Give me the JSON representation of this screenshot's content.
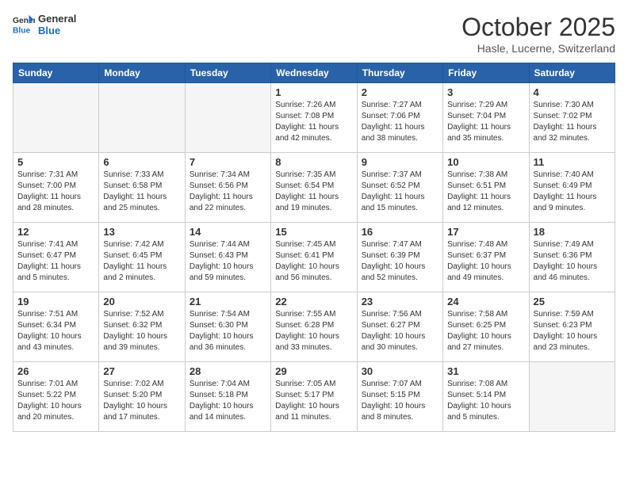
{
  "header": {
    "logo_line1": "General",
    "logo_line2": "Blue",
    "month": "October 2025",
    "location": "Hasle, Lucerne, Switzerland"
  },
  "weekdays": [
    "Sunday",
    "Monday",
    "Tuesday",
    "Wednesday",
    "Thursday",
    "Friday",
    "Saturday"
  ],
  "weeks": [
    [
      {
        "day": "",
        "info": ""
      },
      {
        "day": "",
        "info": ""
      },
      {
        "day": "",
        "info": ""
      },
      {
        "day": "1",
        "info": "Sunrise: 7:26 AM\nSunset: 7:08 PM\nDaylight: 11 hours\nand 42 minutes."
      },
      {
        "day": "2",
        "info": "Sunrise: 7:27 AM\nSunset: 7:06 PM\nDaylight: 11 hours\nand 38 minutes."
      },
      {
        "day": "3",
        "info": "Sunrise: 7:29 AM\nSunset: 7:04 PM\nDaylight: 11 hours\nand 35 minutes."
      },
      {
        "day": "4",
        "info": "Sunrise: 7:30 AM\nSunset: 7:02 PM\nDaylight: 11 hours\nand 32 minutes."
      }
    ],
    [
      {
        "day": "5",
        "info": "Sunrise: 7:31 AM\nSunset: 7:00 PM\nDaylight: 11 hours\nand 28 minutes."
      },
      {
        "day": "6",
        "info": "Sunrise: 7:33 AM\nSunset: 6:58 PM\nDaylight: 11 hours\nand 25 minutes."
      },
      {
        "day": "7",
        "info": "Sunrise: 7:34 AM\nSunset: 6:56 PM\nDaylight: 11 hours\nand 22 minutes."
      },
      {
        "day": "8",
        "info": "Sunrise: 7:35 AM\nSunset: 6:54 PM\nDaylight: 11 hours\nand 19 minutes."
      },
      {
        "day": "9",
        "info": "Sunrise: 7:37 AM\nSunset: 6:52 PM\nDaylight: 11 hours\nand 15 minutes."
      },
      {
        "day": "10",
        "info": "Sunrise: 7:38 AM\nSunset: 6:51 PM\nDaylight: 11 hours\nand 12 minutes."
      },
      {
        "day": "11",
        "info": "Sunrise: 7:40 AM\nSunset: 6:49 PM\nDaylight: 11 hours\nand 9 minutes."
      }
    ],
    [
      {
        "day": "12",
        "info": "Sunrise: 7:41 AM\nSunset: 6:47 PM\nDaylight: 11 hours\nand 5 minutes."
      },
      {
        "day": "13",
        "info": "Sunrise: 7:42 AM\nSunset: 6:45 PM\nDaylight: 11 hours\nand 2 minutes."
      },
      {
        "day": "14",
        "info": "Sunrise: 7:44 AM\nSunset: 6:43 PM\nDaylight: 10 hours\nand 59 minutes."
      },
      {
        "day": "15",
        "info": "Sunrise: 7:45 AM\nSunset: 6:41 PM\nDaylight: 10 hours\nand 56 minutes."
      },
      {
        "day": "16",
        "info": "Sunrise: 7:47 AM\nSunset: 6:39 PM\nDaylight: 10 hours\nand 52 minutes."
      },
      {
        "day": "17",
        "info": "Sunrise: 7:48 AM\nSunset: 6:37 PM\nDaylight: 10 hours\nand 49 minutes."
      },
      {
        "day": "18",
        "info": "Sunrise: 7:49 AM\nSunset: 6:36 PM\nDaylight: 10 hours\nand 46 minutes."
      }
    ],
    [
      {
        "day": "19",
        "info": "Sunrise: 7:51 AM\nSunset: 6:34 PM\nDaylight: 10 hours\nand 43 minutes."
      },
      {
        "day": "20",
        "info": "Sunrise: 7:52 AM\nSunset: 6:32 PM\nDaylight: 10 hours\nand 39 minutes."
      },
      {
        "day": "21",
        "info": "Sunrise: 7:54 AM\nSunset: 6:30 PM\nDaylight: 10 hours\nand 36 minutes."
      },
      {
        "day": "22",
        "info": "Sunrise: 7:55 AM\nSunset: 6:28 PM\nDaylight: 10 hours\nand 33 minutes."
      },
      {
        "day": "23",
        "info": "Sunrise: 7:56 AM\nSunset: 6:27 PM\nDaylight: 10 hours\nand 30 minutes."
      },
      {
        "day": "24",
        "info": "Sunrise: 7:58 AM\nSunset: 6:25 PM\nDaylight: 10 hours\nand 27 minutes."
      },
      {
        "day": "25",
        "info": "Sunrise: 7:59 AM\nSunset: 6:23 PM\nDaylight: 10 hours\nand 23 minutes."
      }
    ],
    [
      {
        "day": "26",
        "info": "Sunrise: 7:01 AM\nSunset: 5:22 PM\nDaylight: 10 hours\nand 20 minutes."
      },
      {
        "day": "27",
        "info": "Sunrise: 7:02 AM\nSunset: 5:20 PM\nDaylight: 10 hours\nand 17 minutes."
      },
      {
        "day": "28",
        "info": "Sunrise: 7:04 AM\nSunset: 5:18 PM\nDaylight: 10 hours\nand 14 minutes."
      },
      {
        "day": "29",
        "info": "Sunrise: 7:05 AM\nSunset: 5:17 PM\nDaylight: 10 hours\nand 11 minutes."
      },
      {
        "day": "30",
        "info": "Sunrise: 7:07 AM\nSunset: 5:15 PM\nDaylight: 10 hours\nand 8 minutes."
      },
      {
        "day": "31",
        "info": "Sunrise: 7:08 AM\nSunset: 5:14 PM\nDaylight: 10 hours\nand 5 minutes."
      },
      {
        "day": "",
        "info": ""
      }
    ]
  ]
}
